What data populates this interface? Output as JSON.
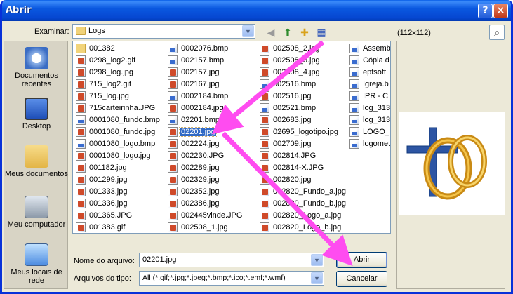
{
  "window": {
    "title": "Abrir",
    "help_glyph": "?",
    "close_glyph": "×"
  },
  "toolbar": {
    "look_in_label": "Examinar:",
    "look_in_value": "Logs",
    "icons": [
      "back-icon",
      "up-folder-icon",
      "new-folder-icon",
      "view-menu-icon"
    ]
  },
  "preview": {
    "size_label": "(112x112)"
  },
  "places": [
    {
      "label": "Documentos recentes",
      "icon": "recent-documents-icon"
    },
    {
      "label": "Desktop",
      "icon": "desktop-icon"
    },
    {
      "label": "Meus documentos",
      "icon": "my-documents-icon"
    },
    {
      "label": "Meu computador",
      "icon": "my-computer-icon"
    },
    {
      "label": "Meus locais de rede",
      "icon": "network-places-icon"
    }
  ],
  "files": {
    "columns": [
      [
        "001382",
        "0298_log2.gif",
        "0298_log.jpg",
        "715_log2.gif",
        "715_log.jpg",
        "715carteirinha.JPG",
        "0001080_fundo.bmp",
        "0001080_fundo.jpg",
        "0001080_logo.bmp",
        "0001080_logo.jpg",
        "001182.jpg",
        "001299.jpg",
        "001333.jpg",
        "001336.jpg",
        "001365.JPG",
        "001383.gif"
      ],
      [
        "0002076.bmp",
        "002157.bmp",
        "002157.jpg",
        "002167.jpg",
        "0002184.bmp",
        "0002184.jpg",
        "02201.bmp",
        "02201.jpg",
        "002224.jpg",
        "002230.JPG",
        "002289.jpg",
        "002329.jpg",
        "002352.jpg",
        "002386.jpg",
        "002445vinde.JPG",
        "002508_1.jpg"
      ],
      [
        "002508_2.jpg",
        "002508_3.jpg",
        "002508_4.jpg",
        "002516.bmp",
        "002516.jpg",
        "002521.bmp",
        "002683.jpg",
        "02695_logotipo.jpg",
        "002709.jpg",
        "002814.JPG",
        "002814-X.JPG",
        "002820.jpg",
        "002820_Fundo_a.jpg",
        "002820_Fundo_b.jpg",
        "002820_Logo_a.jpg",
        "002820_Logo_b.jpg"
      ],
      [
        "Assemb",
        "Cópia d",
        "epfsoft",
        "Igreja.b",
        "IPR - C",
        "log_313",
        "log_313",
        "LOGO_",
        "logomet"
      ]
    ],
    "selected": "02201.jpg"
  },
  "form": {
    "filename_label": "Nome do arquivo:",
    "filename_value": "02201.jpg",
    "filetype_label": "Arquivos do tipo:",
    "filetype_value": "All (*.gif;*.jpg;*.jpeg;*.bmp;*.ico;*.emf;*.wmf)",
    "open_button": "Abrir",
    "cancel_button": "Cancelar"
  },
  "colors": {
    "title_blue": "#0a58e0",
    "selection": "#316ac5",
    "arrow": "#ff4cf0"
  }
}
